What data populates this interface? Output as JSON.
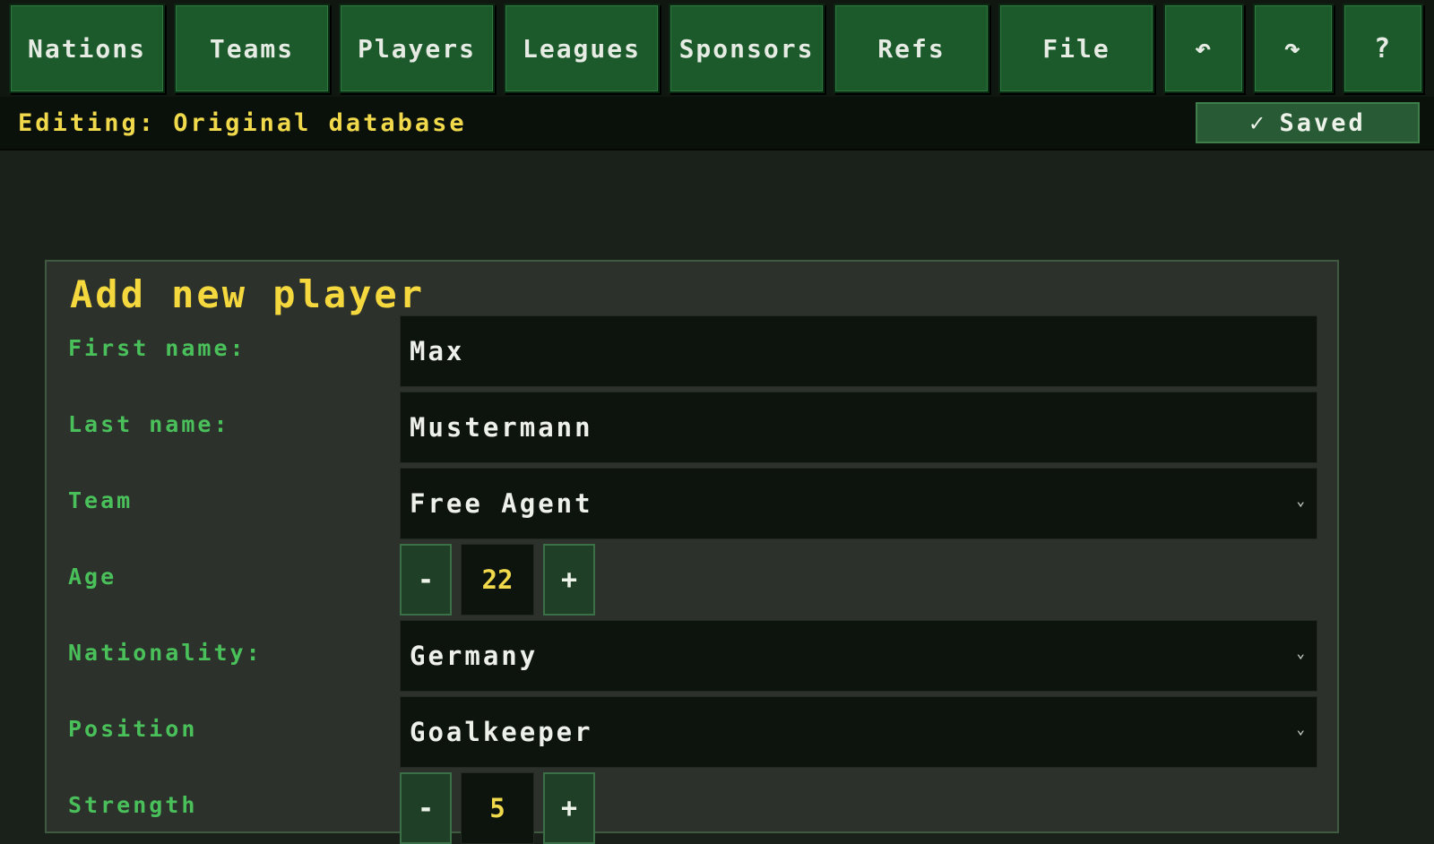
{
  "nav": {
    "items": [
      {
        "label": "Nations"
      },
      {
        "label": "Teams"
      },
      {
        "label": "Players"
      },
      {
        "label": "Leagues"
      },
      {
        "label": "Sponsors"
      },
      {
        "label": "Refs"
      },
      {
        "label": "File"
      }
    ],
    "undo_glyph": "↶",
    "redo_glyph": "↷",
    "help_glyph": "?"
  },
  "status": {
    "editing_text": "Editing: Original database",
    "saved_label": "Saved",
    "saved_glyph": "✓"
  },
  "form": {
    "title": "Add new player",
    "first_name_label": "First name:",
    "first_name_value": "Max",
    "last_name_label": "Last name:",
    "last_name_value": "Mustermann",
    "team_label": "Team",
    "team_value": "Free Agent",
    "age_label": "Age",
    "age_value": "22",
    "nationality_label": "Nationality:",
    "nationality_value": "Germany",
    "position_label": "Position",
    "position_value": "Goalkeeper",
    "next_label": "Strength",
    "next_value": "5",
    "minus_glyph": "-",
    "plus_glyph": "+",
    "chevron_glyph": "⌄"
  },
  "colors": {
    "accent_yellow": "#f4d83e",
    "label_green": "#4ac05a",
    "button_green": "#1c5a2c"
  }
}
